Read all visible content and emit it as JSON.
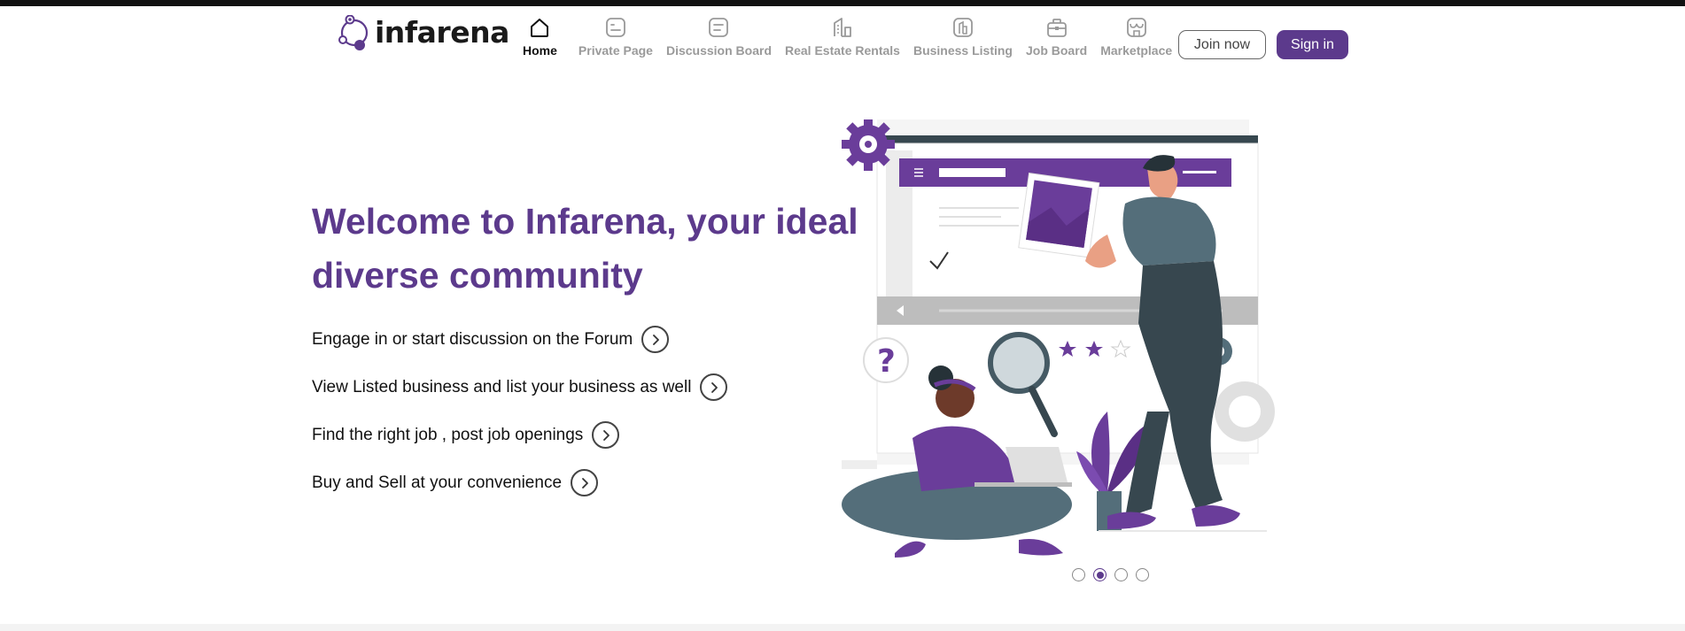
{
  "brand": {
    "name": "infarena",
    "accent": "#5c3a8c"
  },
  "nav": {
    "items": [
      {
        "label": "Home",
        "icon": "home-icon",
        "active": true
      },
      {
        "label": "Private Page",
        "icon": "private-page-icon",
        "active": false
      },
      {
        "label": "Discussion Board",
        "icon": "discussion-board-icon",
        "active": false
      },
      {
        "label": "Real Estate Rentals",
        "icon": "real-estate-icon",
        "active": false
      },
      {
        "label": "Business Listing",
        "icon": "business-listing-icon",
        "active": false
      },
      {
        "label": "Job Board",
        "icon": "job-board-icon",
        "active": false
      },
      {
        "label": "Marketplace",
        "icon": "marketplace-icon",
        "active": false
      }
    ]
  },
  "auth": {
    "join_label": "Join now",
    "signin_label": "Sign in"
  },
  "hero": {
    "title": "Welcome to Infarena, your ideal diverse community",
    "features": [
      {
        "text": "Engage in or start discussion on the Forum"
      },
      {
        "text": "View Listed business and list your business as well"
      },
      {
        "text": "Find the right job , post job openings"
      },
      {
        "text": "Buy and Sell at your convenience"
      }
    ]
  },
  "carousel": {
    "slide_count": 4,
    "active_index": 1
  }
}
